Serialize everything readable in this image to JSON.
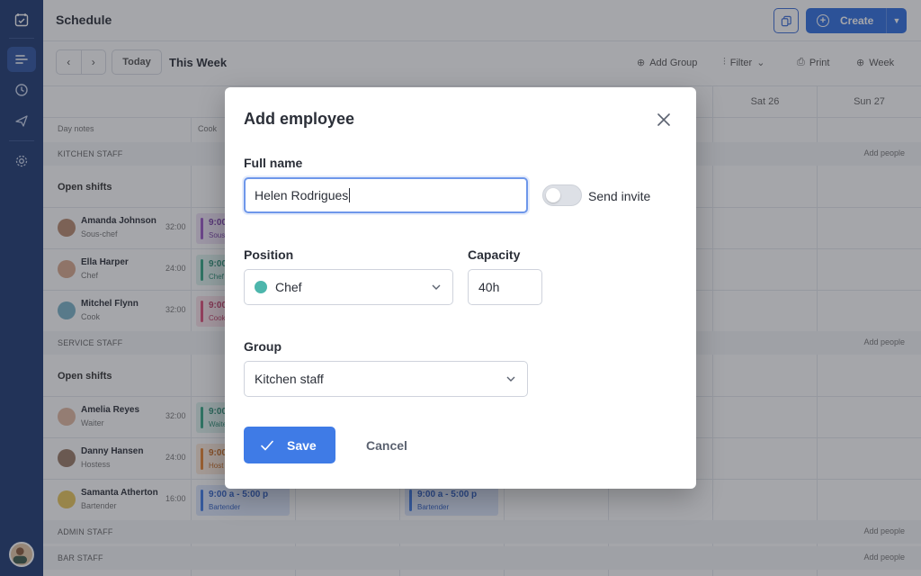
{
  "header": {
    "title": "Schedule",
    "create_label": "Create"
  },
  "toolbar": {
    "today_label": "Today",
    "week_title": "This Week",
    "add_group": "Add Group",
    "filter": "Filter",
    "print": "Print",
    "week": "Week"
  },
  "grid": {
    "days": [
      "Sat 26",
      "Sun 27"
    ],
    "day_notes": "Day notes",
    "cook_col": "Cook",
    "add_people": "Add people",
    "open_shifts": "Open shifts",
    "groups": [
      {
        "name": "KITCHEN STAFF"
      },
      {
        "name": "SERVICE STAFF"
      },
      {
        "name": "ADMIN STAFF"
      },
      {
        "name": "BAR STAFF"
      }
    ],
    "employees": [
      {
        "name": "Amanda Johnson",
        "role": "Sous-chef",
        "hours": "32:00",
        "shift": "9:00",
        "shift_role": "Sous"
      },
      {
        "name": "Ella Harper",
        "role": "Chef",
        "hours": "24:00",
        "shift": "9:00",
        "shift_role": "Chef"
      },
      {
        "name": "Mitchel Flynn",
        "role": "Cook",
        "hours": "32:00",
        "shift": "9:00",
        "shift_role": "Cook"
      },
      {
        "name": "Amelia Reyes",
        "role": "Waiter",
        "hours": "32:00",
        "shift": "9:00",
        "shift_role": "Waite"
      },
      {
        "name": "Danny Hansen",
        "role": "Hostess",
        "hours": "24:00",
        "shift": "9:00",
        "shift_role": "Host"
      },
      {
        "name": "Samanta Atherton",
        "role": "Bartender",
        "hours": "16:00",
        "shift": "9:00 a - 5:00 p",
        "shift_role": "Bartender",
        "shift2": "9:00 a - 5:00 p",
        "shift2_role": "Bartender"
      }
    ]
  },
  "modal": {
    "title": "Add employee",
    "full_name_label": "Full name",
    "full_name_value": "Helen Rodrigues",
    "send_invite_label": "Send invite",
    "send_invite_on": false,
    "position_label": "Position",
    "position_value": "Chef",
    "position_color": "#4db6ac",
    "capacity_label": "Capacity",
    "capacity_value": "40h",
    "group_label": "Group",
    "group_value": "Kitchen staff",
    "save_label": "Save",
    "cancel_label": "Cancel"
  },
  "colors": {
    "sidebar": "#1e3a73",
    "accent": "#3f7be6"
  },
  "icons": [
    "calendar-check-icon",
    "timeline-icon",
    "clock-icon",
    "plane-icon",
    "gear-icon",
    "copy-icon",
    "plus-circle-icon",
    "close-icon",
    "check-icon",
    "chevron-down-icon"
  ]
}
